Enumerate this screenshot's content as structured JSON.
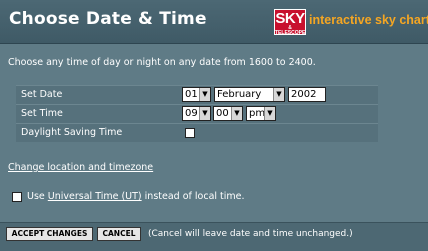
{
  "header": {
    "title": "Choose Date & Time",
    "logo_big": "SKY",
    "logo_small": "& TELESCOPE",
    "logo_text": "interactive sky chart"
  },
  "intro": "Choose any time of day or night on any date from 1600 to 2400.",
  "form": {
    "set_date_label": "Set Date",
    "day": "01",
    "month": "February",
    "year": "2002",
    "set_time_label": "Set Time",
    "hour": "09",
    "minute": "00",
    "ampm": "pm",
    "dst_label": "Daylight Saving Time",
    "dst_checked": false
  },
  "change_location_link": "Change location and timezone",
  "ut": {
    "checked": false,
    "prefix": "Use ",
    "link": "Universal Time (UT)",
    "suffix": " instead of local time."
  },
  "footer": {
    "accept_label": "ACCEPT CHANGES",
    "cancel_label": "CANCEL",
    "note": "(Cancel will leave date and time unchanged.)"
  }
}
